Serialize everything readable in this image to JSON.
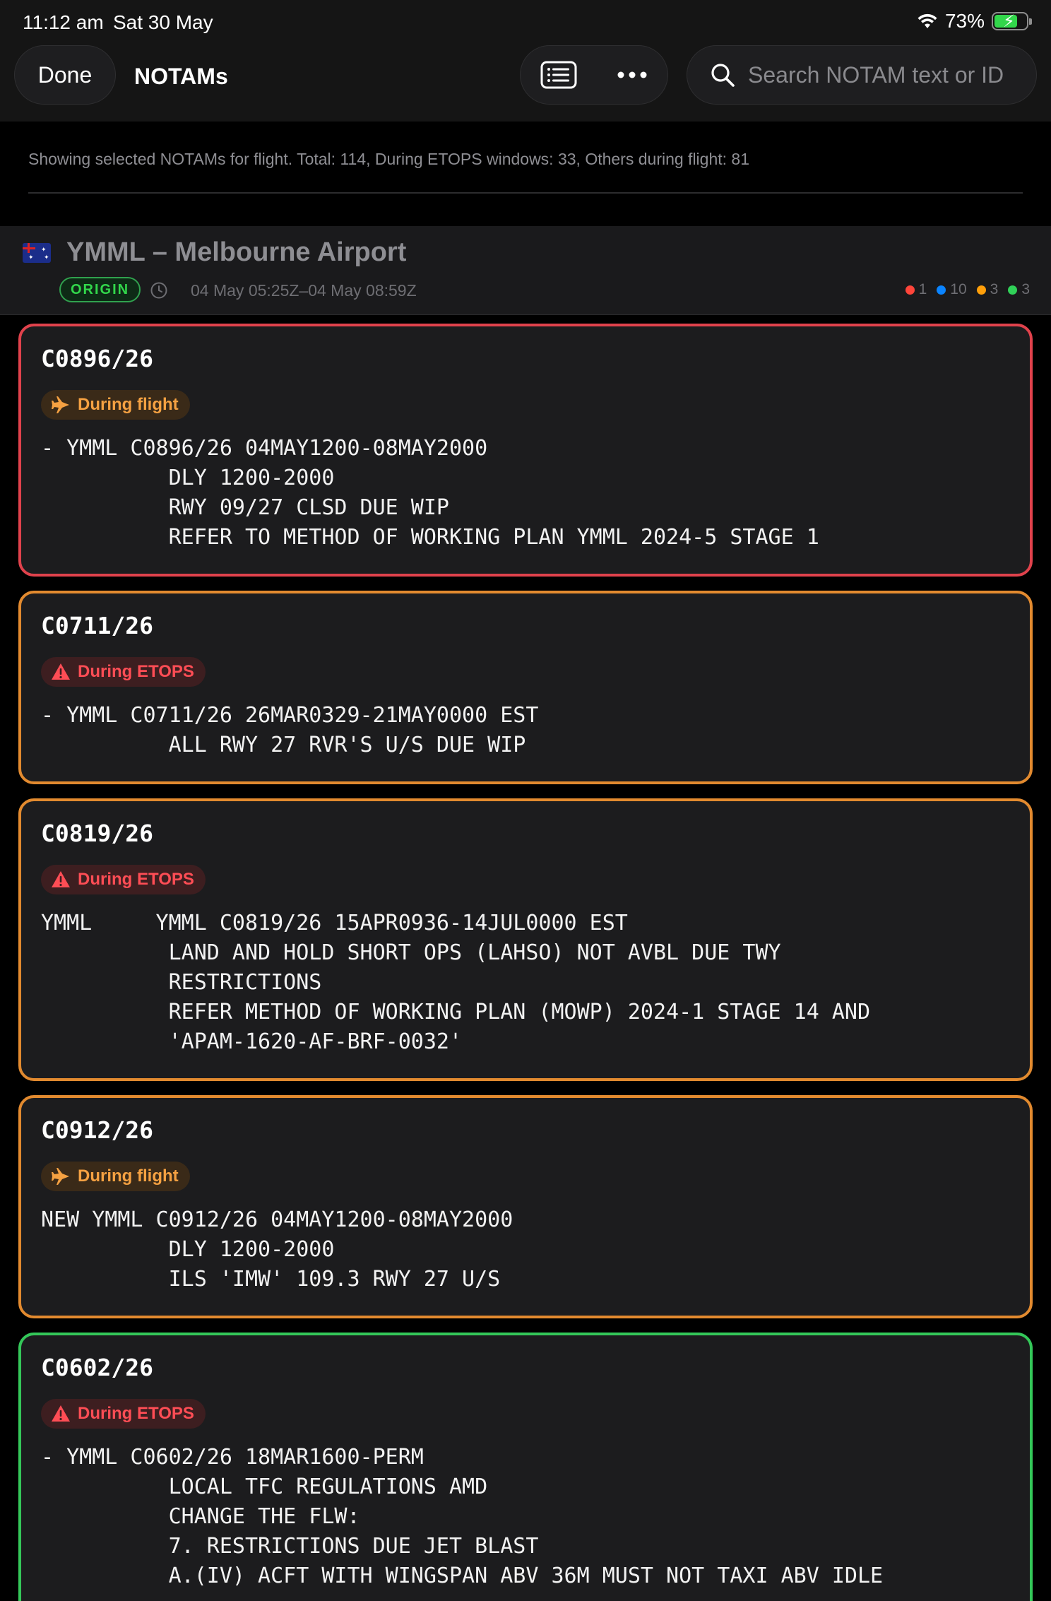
{
  "status_bar": {
    "time": "11:12 am",
    "date": "Sat 30 May",
    "battery": "73%",
    "battery_level": 0.73
  },
  "nav": {
    "done_label": "Done",
    "title": "NOTAMs",
    "search_placeholder": "Search NOTAM text or ID",
    "icons": [
      "list-icon",
      "more-icon",
      "search-icon"
    ]
  },
  "info": {
    "text": "Showing selected NOTAMs for flight. Total: 114, During ETOPS windows: 33, Others during flight: 81"
  },
  "airport": {
    "title": "YMML – Melbourne Airport",
    "badge": "ORIGIN",
    "window": "04 May 05:25Z–04 May 08:59Z",
    "counts": [
      {
        "value": "1",
        "color": "#ff453a"
      },
      {
        "value": "10",
        "color": "#0a84ff"
      },
      {
        "value": "3",
        "color": "#ff9f0a"
      },
      {
        "value": "3",
        "color": "#30d158"
      }
    ]
  },
  "notams": [
    {
      "id": "C0896/26",
      "tag": "During flight",
      "tag_kind": "flight",
      "border": "#e0424c",
      "text": "- YMML C0896/26 04MAY1200-08MAY2000\n          DLY 1200-2000\n          RWY 09/27 CLSD DUE WIP\n          REFER TO METHOD OF WORKING PLAN YMML 2024-5 STAGE 1"
    },
    {
      "id": "C0711/26",
      "tag": "During ETOPS",
      "tag_kind": "etops",
      "border": "#e28a2f",
      "text": "- YMML C0711/26 26MAR0329-21MAY0000 EST\n          ALL RWY 27 RVR'S U/S DUE WIP"
    },
    {
      "id": "C0819/26",
      "tag": "During ETOPS",
      "tag_kind": "etops",
      "border": "#e28a2f",
      "text": "YMML     YMML C0819/26 15APR0936-14JUL0000 EST\n          LAND AND HOLD SHORT OPS (LAHSO) NOT AVBL DUE TWY\n          RESTRICTIONS\n          REFER METHOD OF WORKING PLAN (MOWP) 2024-1 STAGE 14 AND\n          'APAM-1620-AF-BRF-0032'"
    },
    {
      "id": "C0912/26",
      "tag": "During flight",
      "tag_kind": "flight",
      "border": "#e28a2f",
      "text": "NEW YMML C0912/26 04MAY1200-08MAY2000\n          DLY 1200-2000\n          ILS 'IMW' 109.3 RWY 27 U/S"
    },
    {
      "id": "C0602/26",
      "tag": "During ETOPS",
      "tag_kind": "etops",
      "border": "#34c759",
      "text": "- YMML C0602/26 18MAR1600-PERM\n          LOCAL TFC REGULATIONS AMD\n          CHANGE THE FLW:\n          7. RESTRICTIONS DUE JET BLAST\n          A.(IV) ACFT WITH WINGSPAN ABV 36M MUST NOT TAXI ABV IDLE"
    }
  ]
}
